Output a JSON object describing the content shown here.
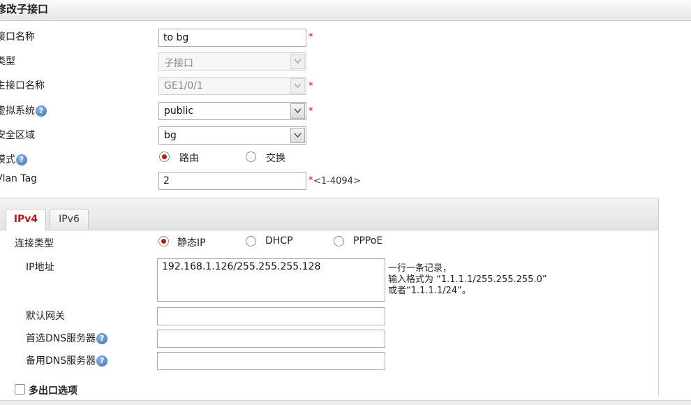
{
  "header": {
    "title": "修改子接口"
  },
  "form": {
    "interface_name": {
      "label": "接口名称",
      "value": "to bg",
      "required": "*"
    },
    "type": {
      "label": "类型",
      "value": "子接口"
    },
    "main_interface": {
      "label": "主接口名称",
      "value": "GE1/0/1",
      "required": "*"
    },
    "vsys": {
      "label": "虚拟系统",
      "value": "public",
      "required": "*"
    },
    "zone": {
      "label": "安全区域",
      "value": "bg"
    },
    "mode": {
      "label": "模式",
      "options": [
        "路由",
        "交换"
      ],
      "selected": "路由"
    },
    "vlan": {
      "label": "Vlan Tag",
      "value": "2",
      "required": "*",
      "range": "<1-4094>"
    }
  },
  "tabs": [
    {
      "label": "IPv4",
      "active": true
    },
    {
      "label": "IPv6",
      "active": false
    }
  ],
  "ipv4": {
    "conn_type": {
      "label": "连接类型",
      "options": [
        "静态IP",
        "DHCP",
        "PPPoE"
      ],
      "selected": "静态IP"
    },
    "ip": {
      "label": "IP地址",
      "value": "192.168.1.126/255.255.255.128",
      "hint": [
        "一行一条记录，",
        "输入格式为 “1.1.1.1/255.255.255.0”",
        "或者“1.1.1.1/24”。"
      ]
    },
    "gateway": {
      "label": "默认网关",
      "value": ""
    },
    "dns1": {
      "label": "首选DNS服务器",
      "value": ""
    },
    "dns2": {
      "label": "备用DNS服务器",
      "value": ""
    },
    "multi_exit": {
      "label": "多出口选项"
    }
  },
  "icons": {
    "help": "?"
  },
  "colors": {
    "accent": "#c0161b",
    "required": "#dd0000"
  }
}
